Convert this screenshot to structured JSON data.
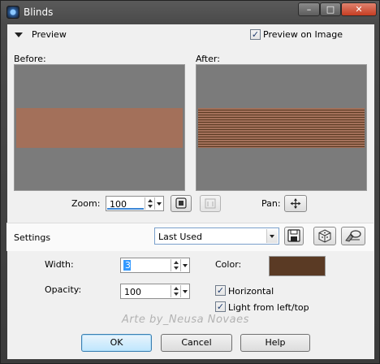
{
  "window": {
    "title": "Blinds"
  },
  "title_buttons": {
    "minimize": "–",
    "maximize": "□",
    "close": "✕"
  },
  "preview": {
    "label": "Preview",
    "preview_on_image_label": "Preview on Image",
    "preview_on_image_checked": true,
    "before_label": "Before:",
    "after_label": "After:"
  },
  "zoom": {
    "label": "Zoom:",
    "value": "100"
  },
  "pan": {
    "label": "Pan:"
  },
  "settings": {
    "label": "Settings",
    "preset": "Last Used"
  },
  "params": {
    "width_label": "Width:",
    "width_value": "3",
    "opacity_label": "Opacity:",
    "opacity_value": "100",
    "color_label": "Color:",
    "color_value": "#5a3a24",
    "horizontal_label": "Horizontal",
    "horizontal_checked": true,
    "light_label": "Light from left/top",
    "light_checked": true
  },
  "watermark": "Arte by_Neusa Novaes",
  "buttons": {
    "ok": "OK",
    "cancel": "Cancel",
    "help": "Help"
  },
  "icons": {
    "app": "blinds-app-icon",
    "fit": "fit-to-window-icon",
    "actual": "actual-size-icon",
    "pan": "pan-move-icon",
    "save": "save-preset-icon",
    "reset": "reset-cube-icon",
    "editor": "preset-editor-icon"
  },
  "colors": {
    "band": "#a3705a",
    "pane_bg": "#7b7b7b"
  }
}
